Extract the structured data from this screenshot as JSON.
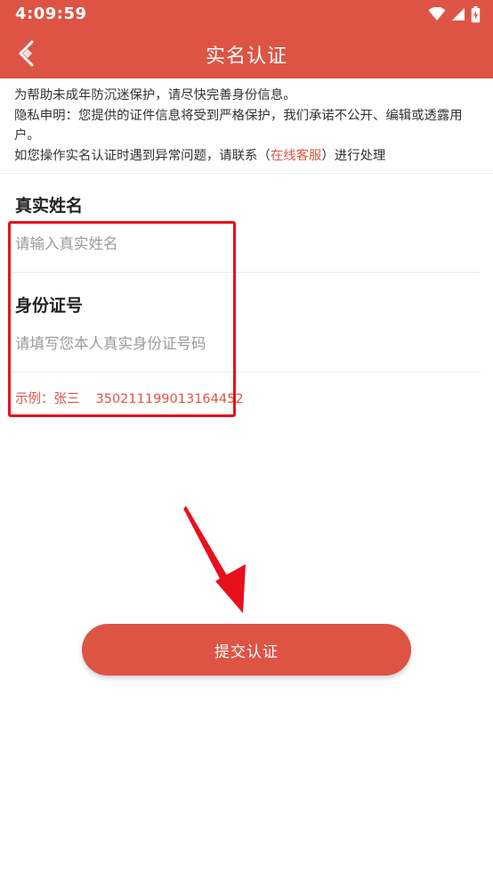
{
  "status_bar": {
    "time": "4:09:59",
    "icons": [
      "wifi-icon",
      "signal-icon",
      "battery-charging-icon"
    ]
  },
  "app_bar": {
    "title": "实名认证",
    "back_icon": "back-arrow-icon"
  },
  "notice": {
    "line1": "为帮助未成年防沉迷保护，请尽快完善身份信息。",
    "line2": "隐私申明：您提供的证件信息将受到严格保护，我们承诺不公开、编辑或透露用户。",
    "line3_prefix": "如您操作实名认证时遇到异常问题，请联系（",
    "line3_link": "在线客服",
    "line3_suffix": "）进行处理"
  },
  "form": {
    "name_label": "真实姓名",
    "name_value": "",
    "name_placeholder": "请输入真实姓名",
    "id_label": "身份证号",
    "id_value": "",
    "id_placeholder": "请填写您本人真实身份证号码",
    "example_prefix": "示例：张三",
    "example_number": "350211199013164452"
  },
  "submit": {
    "label": "提交认证"
  },
  "colors": {
    "brand": "#de5444",
    "highlight": "#e8101a",
    "placeholder": "#9a9a9a"
  }
}
